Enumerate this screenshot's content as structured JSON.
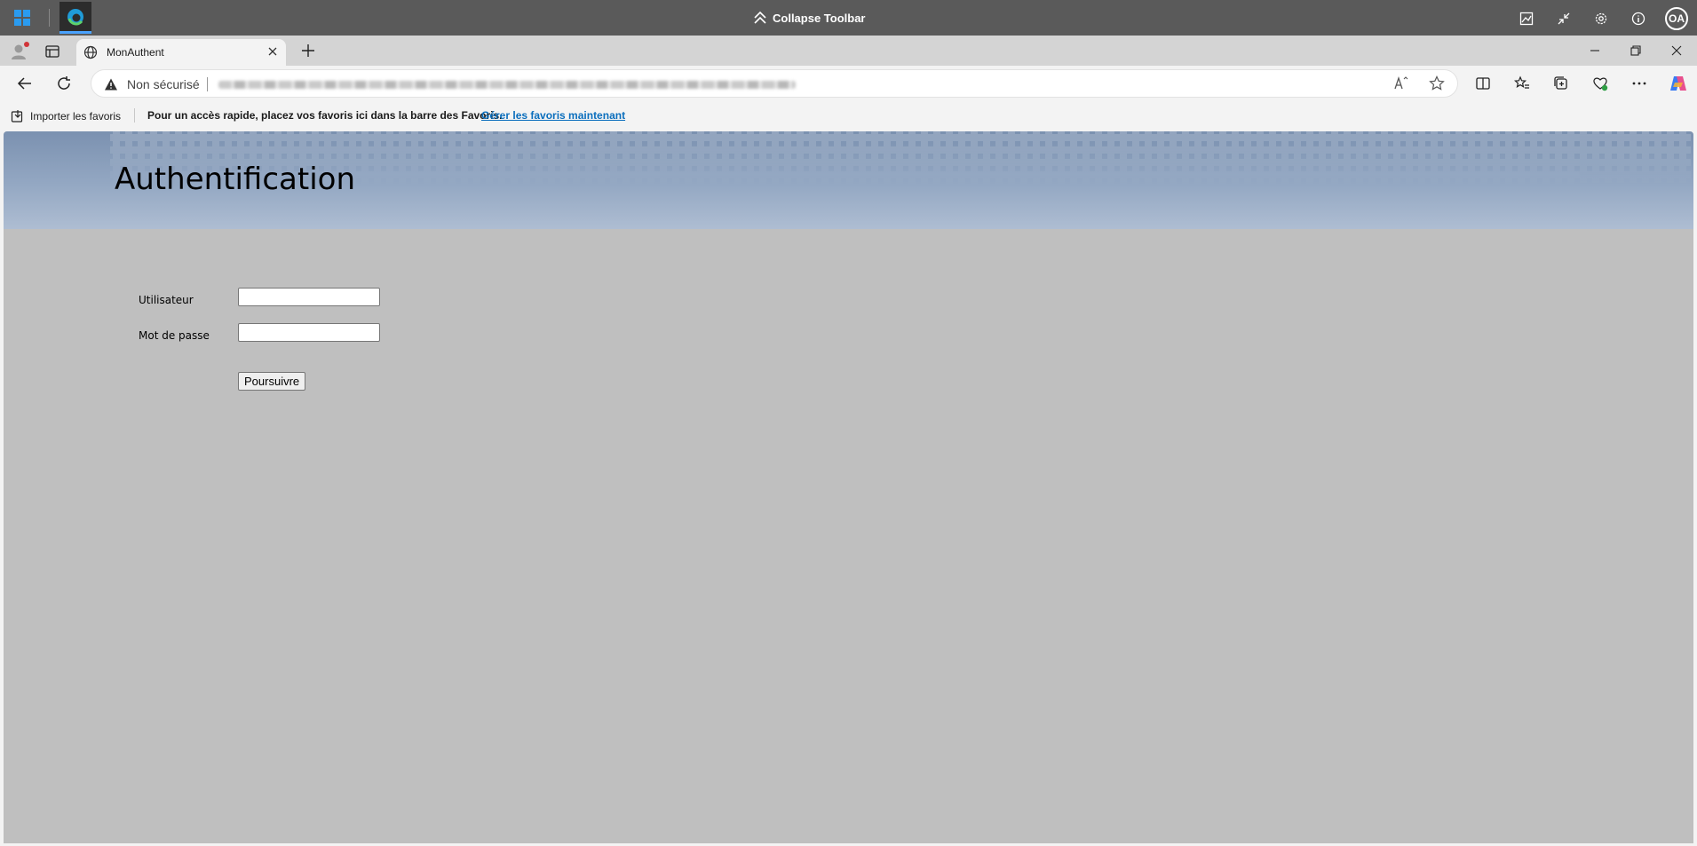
{
  "remote_toolbar": {
    "collapse_label": "Collapse Toolbar",
    "avatar_initials": "OA"
  },
  "browser": {
    "tab_title": "MonAuthent",
    "security_label": "Non sécurisé",
    "accent_color": "#0a6ebd"
  },
  "favorites_bar": {
    "import_label": "Importer les favoris",
    "hint": "Pour un accès rapide, placez vos favoris ici dans la barre des Favoris.",
    "manage_link": "Gérer les favoris maintenant"
  },
  "page": {
    "title": "Authentification",
    "username_label": "Utilisateur",
    "username_value": "",
    "password_label": "Mot de passe",
    "password_value": "",
    "submit_label": "Poursuivre",
    "background_color": "#bfbfbf"
  }
}
